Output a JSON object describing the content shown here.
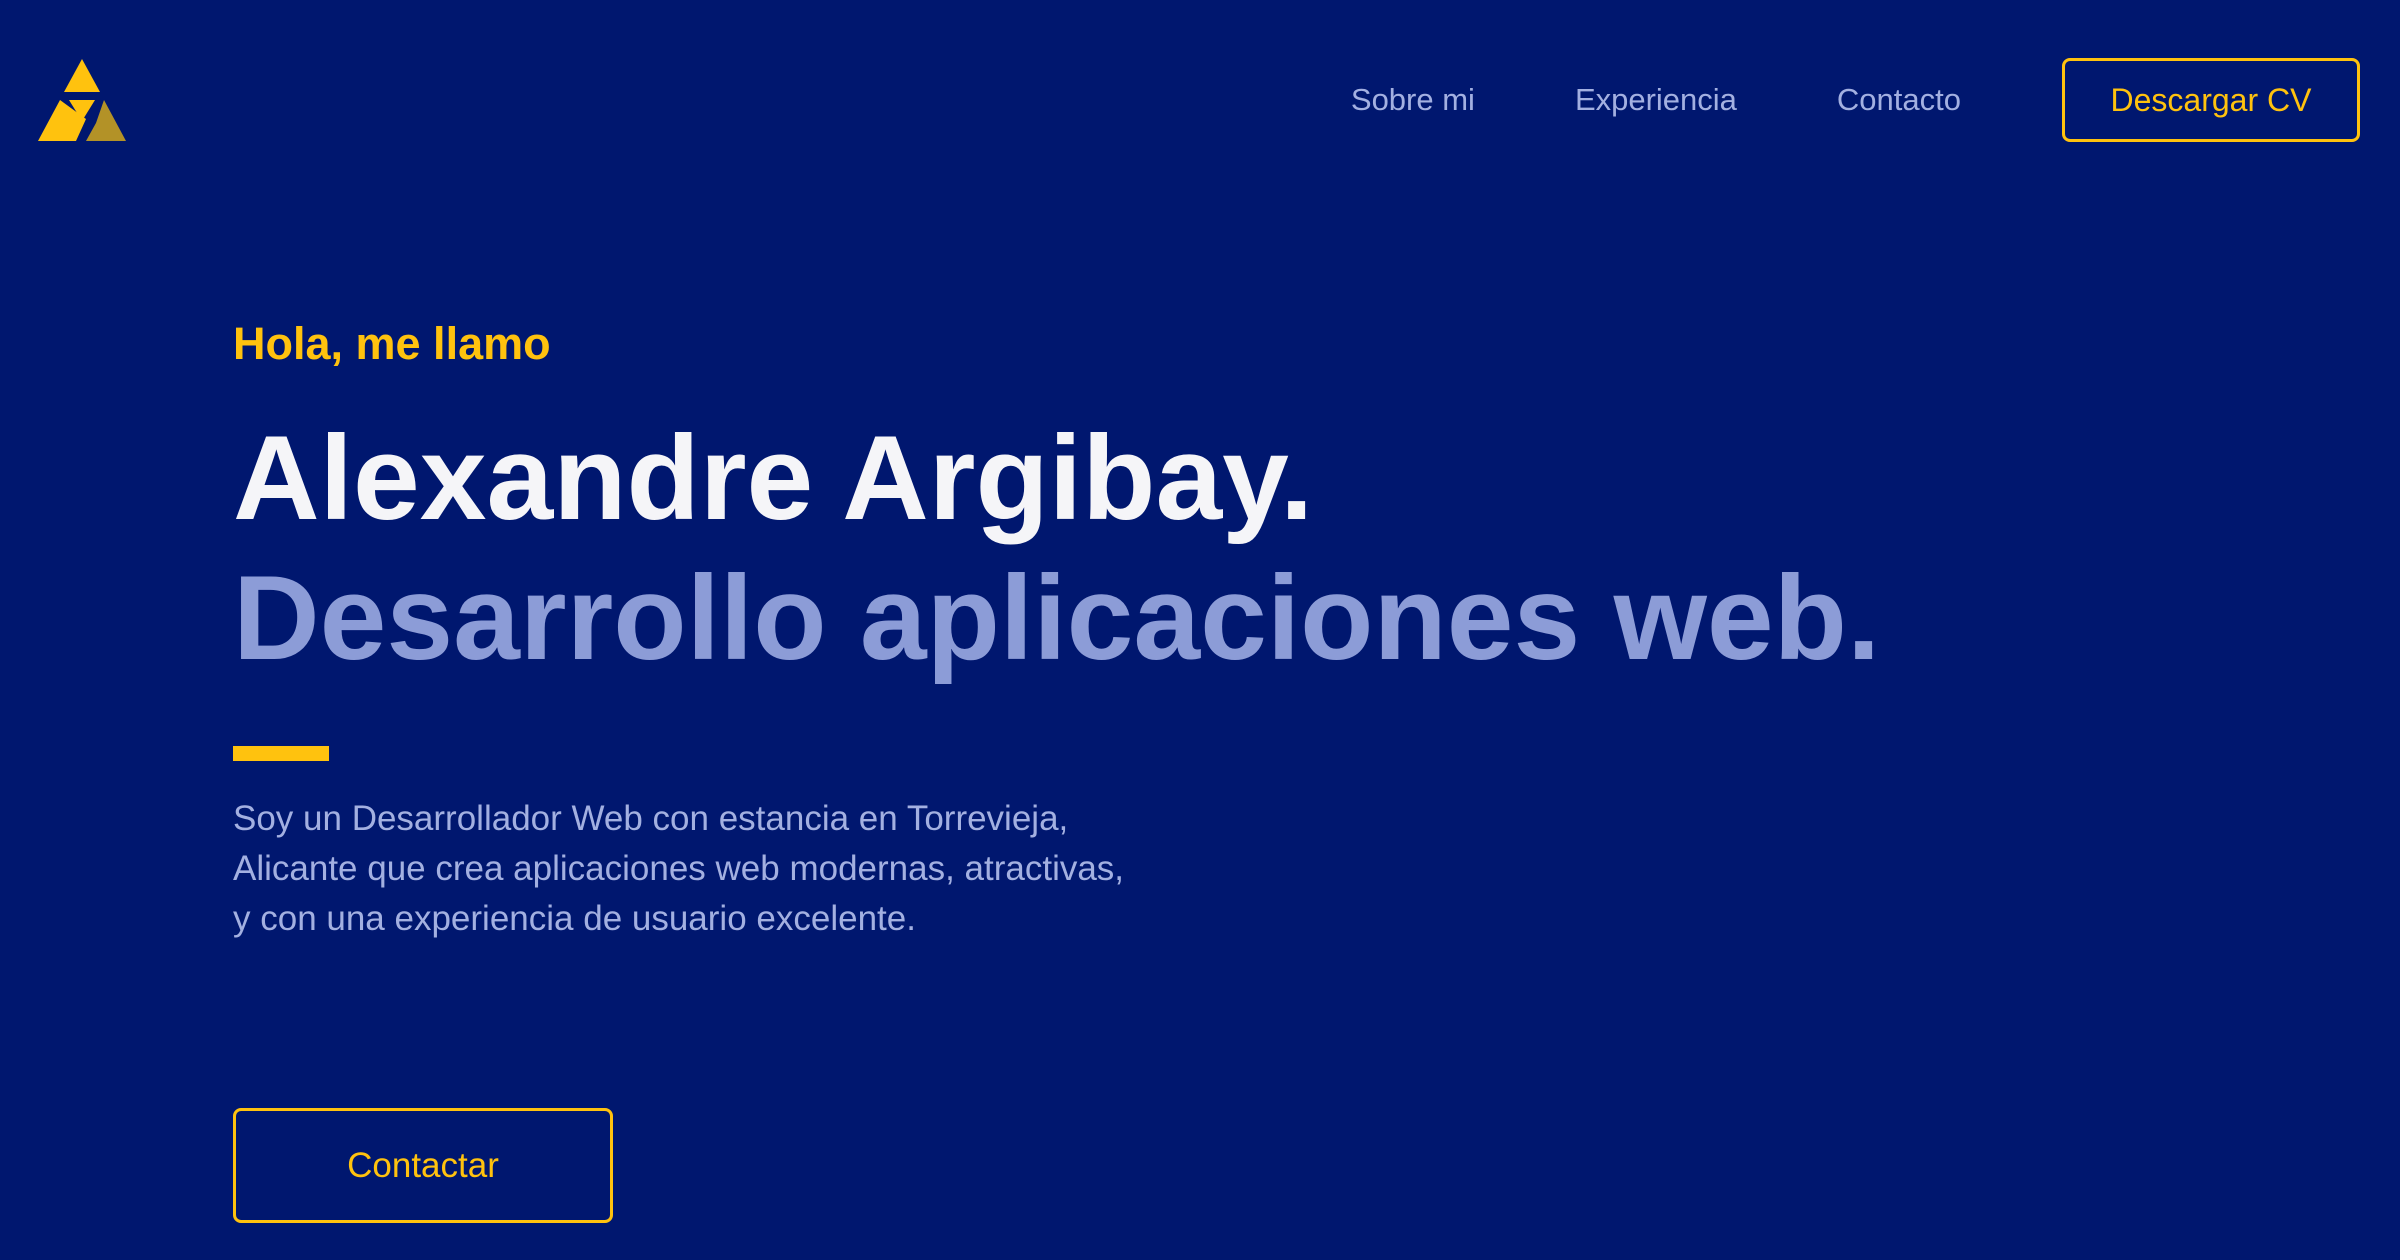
{
  "header": {
    "logo_icon": "triangle-logo-icon",
    "nav": [
      {
        "label": "Sobre mi"
      },
      {
        "label": "Experiencia"
      },
      {
        "label": "Contacto"
      }
    ],
    "cv_button_label": "Descargar CV"
  },
  "hero": {
    "greeting": "Hola, me llamo",
    "name": "Alexandre Argibay.",
    "tagline": "Desarrollo aplicaciones web.",
    "description": [
      "Soy un Desarrollador Web con estancia en Torrevieja,",
      "Alicante que crea aplicaciones web modernas, atractivas,",
      "y con una experiencia de usuario excelente."
    ],
    "contact_button_label": "Contactar"
  },
  "colors": {
    "background": "#00176f",
    "accent": "#ffc20e",
    "accent_dark": "#b39227",
    "text_primary": "#f5f5f8",
    "text_secondary": "#8c9cd7",
    "nav_text": "#a3b0e1"
  }
}
